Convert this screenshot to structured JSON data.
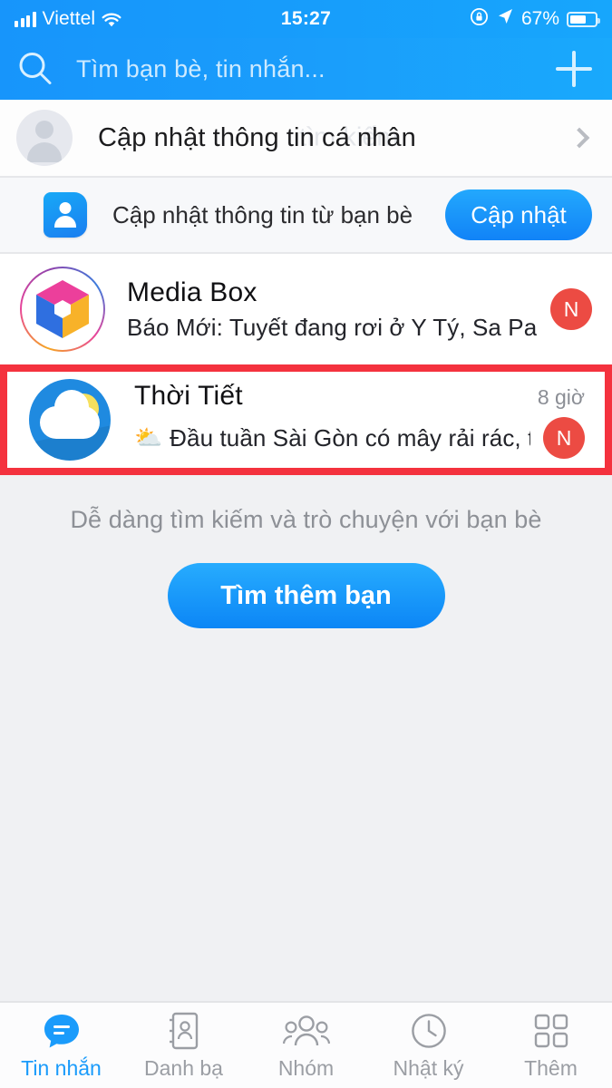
{
  "status_bar": {
    "carrier": "Viettel",
    "time": "15:27",
    "battery_percent": "67%",
    "icons": [
      "signal-bars-icon",
      "wifi-icon",
      "rotation-lock-icon",
      "location-arrow-icon",
      "battery-icon"
    ]
  },
  "header": {
    "search_placeholder": "Tìm bạn bè, tin nhắn...",
    "search_icon": "search-icon",
    "add_icon": "plus-icon",
    "accent_color": "#1a9cfb"
  },
  "profile_row": {
    "title": "Cập nhật thông tin cá nhân",
    "ghost_text": "tìm kiếm",
    "chevron": "chevron-right-icon",
    "avatar": "person-placeholder-avatar"
  },
  "friend_update_banner": {
    "icon": "contact-book-icon",
    "label": "Cập nhật thông tin từ bạn bè",
    "button_label": "Cập nhật"
  },
  "conversations": [
    {
      "name": "Media Box",
      "message": "Báo Mới: Tuyết đang rơi ở Y Tý, Sa Pa",
      "time": "",
      "badge": "N",
      "emoji": "",
      "avatar": "media-box-cube-logo",
      "highlighted": false
    },
    {
      "name": "Thời Tiết",
      "message": "Đầu tuần Sài Gòn có mây rải rác, t...",
      "time": "8 giờ",
      "badge": "N",
      "emoji": "⛅",
      "avatar": "weather-cloud-sun-logo",
      "highlighted": true
    }
  ],
  "empty_state": {
    "text": "Dễ dàng tìm kiếm và trò chuyện với bạn bè",
    "button_label": "Tìm thêm bạn"
  },
  "tabbar": {
    "items": [
      {
        "label": "Tin nhắn",
        "icon": "chat-bubble-icon",
        "active": true
      },
      {
        "label": "Danh bạ",
        "icon": "contact-card-icon",
        "active": false
      },
      {
        "label": "Nhóm",
        "icon": "group-people-icon",
        "active": false
      },
      {
        "label": "Nhật ký",
        "icon": "clock-icon",
        "active": false
      },
      {
        "label": "Thêm",
        "icon": "grid-more-icon",
        "active": false
      }
    ]
  },
  "highlight_color": "#f4323e",
  "badge_color": "#ec4b43"
}
